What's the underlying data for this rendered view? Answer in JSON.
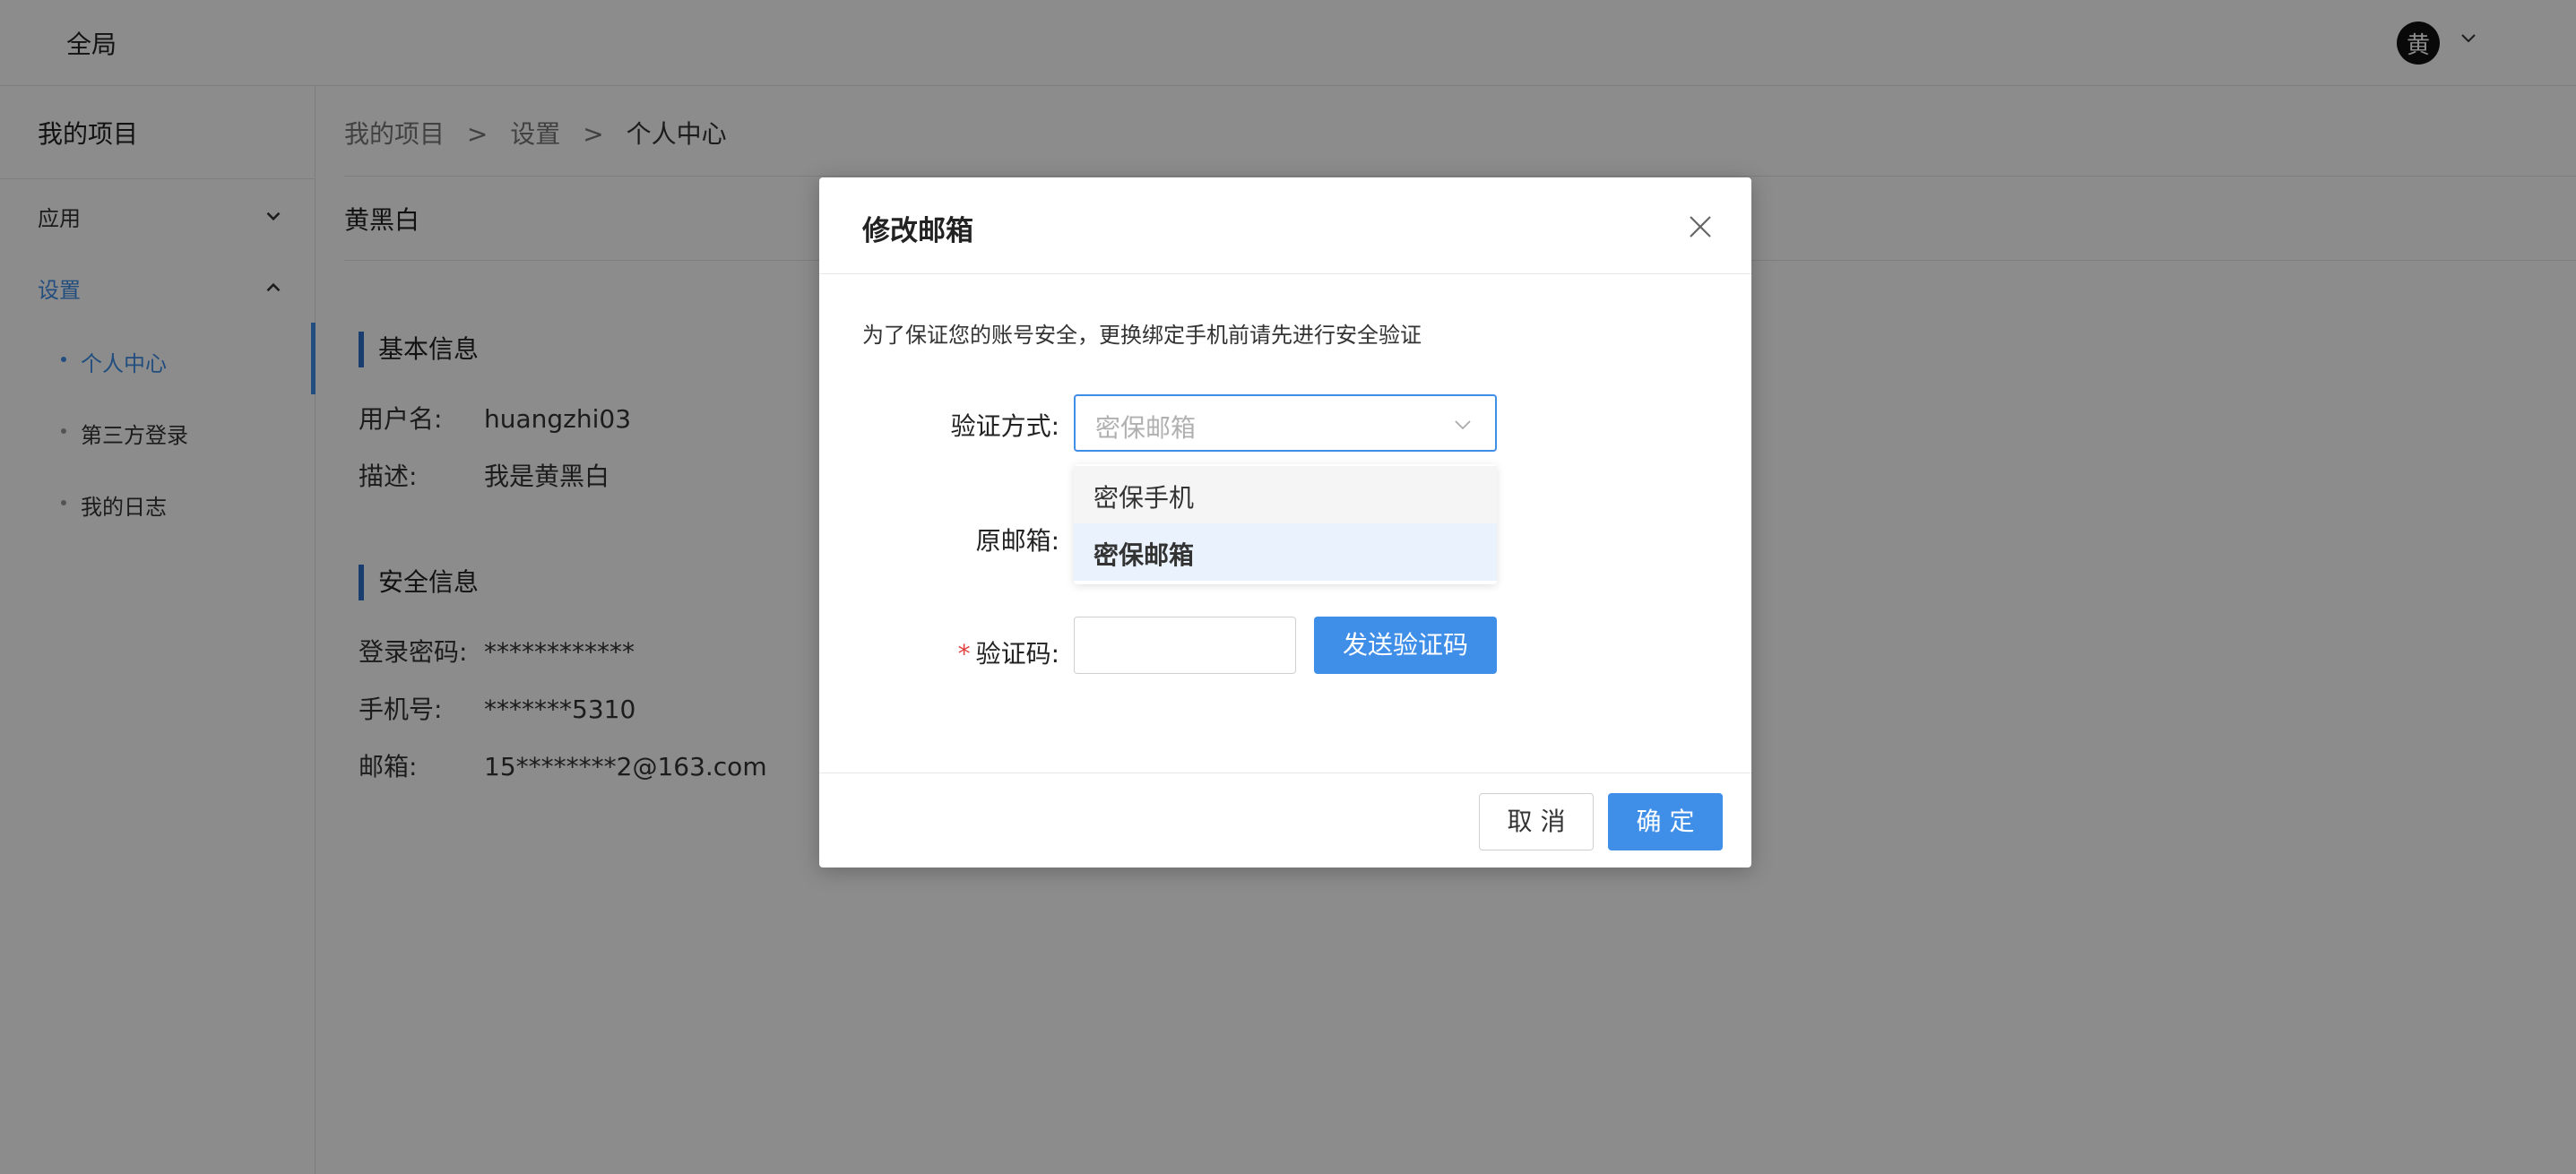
{
  "header": {
    "title": "全局",
    "avatar_text": "黄",
    "avatar_caret_icon": "chevron-down-icon"
  },
  "sidebar": {
    "project_title": "我的项目",
    "groups": [
      {
        "label": "应用",
        "expanded": false,
        "icon": "chevron-down-icon"
      },
      {
        "label": "设置",
        "expanded": true,
        "icon": "chevron-up-icon"
      }
    ],
    "sub_items": [
      {
        "label": "个人中心",
        "active": true
      },
      {
        "label": "第三方登录",
        "active": false
      },
      {
        "label": "我的日志",
        "active": false
      }
    ]
  },
  "breadcrumb": {
    "items": [
      "我的项目",
      "设置",
      "个人中心"
    ],
    "separator": ">"
  },
  "profile": {
    "name": "黄黑白",
    "basic": {
      "heading": "基本信息",
      "rows": [
        {
          "key": "用户名:",
          "value": "huangzhi03"
        },
        {
          "key": "描述:",
          "value": "我是黄黑白"
        }
      ]
    },
    "security": {
      "heading": "安全信息",
      "rows": [
        {
          "key": "登录密码:",
          "value": "************"
        },
        {
          "key": "手机号:",
          "value": "*******5310"
        },
        {
          "key": "邮箱:",
          "value": "15********2@163.com"
        }
      ]
    }
  },
  "modal": {
    "title": "修改邮箱",
    "close_icon": "close-icon",
    "notice": "为了保证您的账号安全，更换绑定手机前请先进行安全验证",
    "fields": {
      "method_label": "验证方式:",
      "method_placeholder": "密保邮箱",
      "original_email_label": "原邮箱:",
      "code_label": "验证码:",
      "code_required_mark": "*",
      "send_code_label": "发送验证码"
    },
    "dropdown_options": [
      {
        "label": "密保手机",
        "hovered": true,
        "selected": false
      },
      {
        "label": "密保邮箱",
        "hovered": false,
        "selected": true
      }
    ],
    "footer": {
      "cancel_label": "取 消",
      "confirm_label": "确 定"
    }
  },
  "colors": {
    "accent": "#3f8ee8",
    "required": "#e0403f",
    "mask": "rgba(0,0,0,0.45)"
  }
}
